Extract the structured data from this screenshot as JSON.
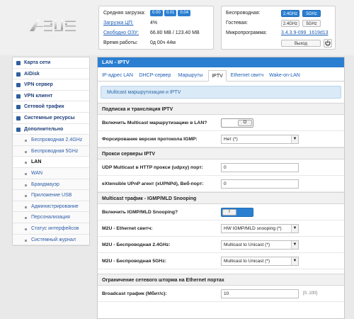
{
  "logo": {
    "text": "ASUS"
  },
  "status": {
    "cpu_load_label": "Средняя загрузка:",
    "cpu_load_values": [
      "0.00",
      "0.01",
      "0.04"
    ],
    "cpu_label": "Загрузка ЦП:",
    "cpu_value": "4%",
    "ram_label": "Свободно ОЗУ:",
    "ram_value": "66.80 MB / 123.40 MB",
    "uptime_label": "Время работы:",
    "uptime_value": "0д 00ч 44м"
  },
  "wireless": {
    "wireless_label": "Беспроводная:",
    "guest_label": "Гостевая:",
    "firmware_label": "Микропрограмма:",
    "band_24": "2.4GHz",
    "band_5": "5GHz",
    "firmware_value": "3.4.3.9-099_1619d13",
    "logout": "Выход",
    "power_icon": "power-icon"
  },
  "sidebar": {
    "items": [
      {
        "label": "Карта сети"
      },
      {
        "label": "AiDisk"
      },
      {
        "label": "VPN сервер"
      },
      {
        "label": "VPN клиент"
      },
      {
        "label": "Сетевой трафик"
      },
      {
        "label": "Системные ресурсы"
      },
      {
        "label": "Дополнительно"
      }
    ],
    "subitems": [
      {
        "label": "Беспроводная 2.4GHz"
      },
      {
        "label": "Беспроводная 5GHz"
      },
      {
        "label": "LAN"
      },
      {
        "label": "WAN"
      },
      {
        "label": "Брандмауэр"
      },
      {
        "label": "Приложение USB"
      },
      {
        "label": "Администрирование"
      },
      {
        "label": "Персонализация"
      },
      {
        "label": "Статус интерфейсов"
      },
      {
        "label": "Системный журнал"
      }
    ]
  },
  "main": {
    "title": "LAN - IPTV",
    "tabs": [
      "IP-адрес LAN",
      "DHCP-сервер",
      "Маршруты",
      "IPTV",
      "Ethernet свитч",
      "Wake-on-LAN"
    ],
    "alert": "Multicast маршрутизация и IPTV",
    "sections": {
      "s1": "Подписка и трансляция IPTV",
      "s2": "Прокси серверы IPTV",
      "s3": "Multicast трафик - IGMP/MLD Snooping",
      "s4": "Ограничение сетевого шторма на Ethernet портах"
    },
    "fields": {
      "multicast_label": "Включить Multicast маршрутизацию в LAN?",
      "igmp_version_label": "Форсирование версии протокола IGMP:",
      "igmp_version_value": "Нет (*)",
      "udpxy_label": "UDP Multicast в HTTP прокси (udpxy) порт:",
      "udpxy_value": "0",
      "xupnpd_label": "eXtensible UPnP агент (xUPNPd), Веб-порт:",
      "xupnpd_value": "0",
      "snooping_label": "Включить IGMP/MLD Snooping?",
      "m2u_eth_label": "M2U - Ethernet свитч:",
      "m2u_eth_value": "HW IGMP/MLD snooping (*)",
      "m2u_24_label": "M2U - Беспроводная 2.4GHz:",
      "m2u_24_value": "Multicast to Unicast (*)",
      "m2u_5_label": "M2U - Беспроводная 5GHz:",
      "m2u_5_value": "Multicast to Unicast (*)",
      "broadcast_label": "Broadcast трафик (Мбит/с):",
      "broadcast_value": "10",
      "broadcast_hint": "[0..100]"
    }
  },
  "colors": {
    "accent": "#2a7fd1"
  }
}
